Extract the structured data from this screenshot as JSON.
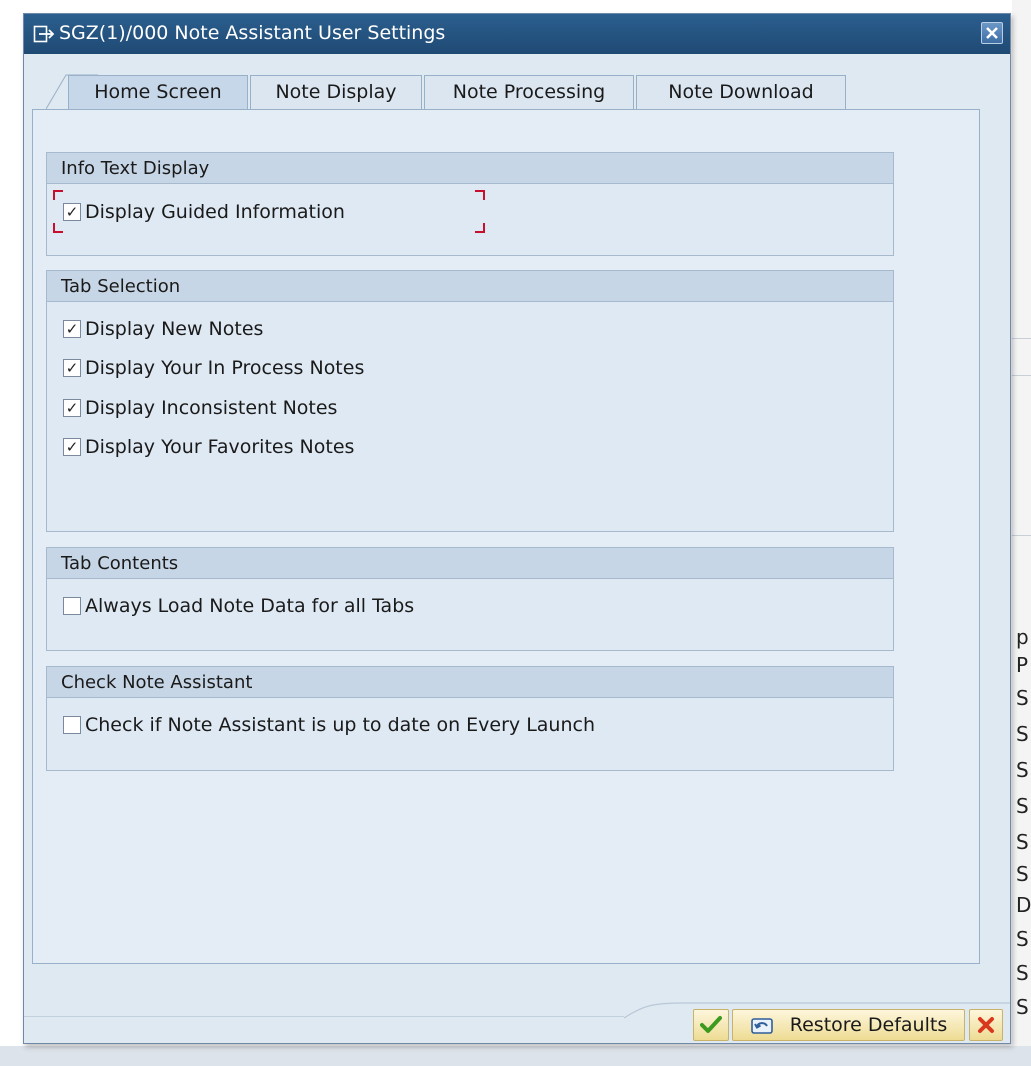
{
  "window": {
    "title": "SGZ(1)/000 Note Assistant User Settings",
    "close_icon": "close-icon"
  },
  "tabs": [
    {
      "label": "Home Screen",
      "active": true
    },
    {
      "label": "Note Display",
      "active": false
    },
    {
      "label": "Note Processing",
      "active": false
    },
    {
      "label": "Note Download",
      "active": false
    }
  ],
  "groups": {
    "info_text": {
      "header": "Info Text Display",
      "items": [
        {
          "label": "Display Guided Information",
          "checked": true
        }
      ]
    },
    "tab_selection": {
      "header": "Tab Selection",
      "items": [
        {
          "label": "Display New Notes",
          "checked": true
        },
        {
          "label": "Display Your In Process Notes",
          "checked": true
        },
        {
          "label": "Display Inconsistent Notes",
          "checked": true
        },
        {
          "label": "Display Your Favorites Notes",
          "checked": true
        }
      ]
    },
    "tab_contents": {
      "header": "Tab Contents",
      "items": [
        {
          "label": "Always Load Note Data for all Tabs",
          "checked": false
        }
      ]
    },
    "check_assistant": {
      "header": "Check Note Assistant",
      "items": [
        {
          "label": "Check if Note Assistant is up to date on Every Launch",
          "checked": false
        }
      ]
    }
  },
  "footer": {
    "confirm_icon": "checkmark-icon",
    "restore_label": "Restore Defaults",
    "restore_icon": "undo-icon",
    "cancel_icon": "cancel-icon"
  },
  "background": {
    "letters": [
      "p",
      "P",
      "S",
      "S",
      "S",
      "S",
      "S",
      "S",
      "D",
      "S",
      "S",
      "S"
    ]
  },
  "colors": {
    "titlebar": "#2b5e8e",
    "panel": "#e4edf6",
    "group_header": "#c7d6e6",
    "focus": "#c8102e",
    "button": "#eedc93"
  }
}
